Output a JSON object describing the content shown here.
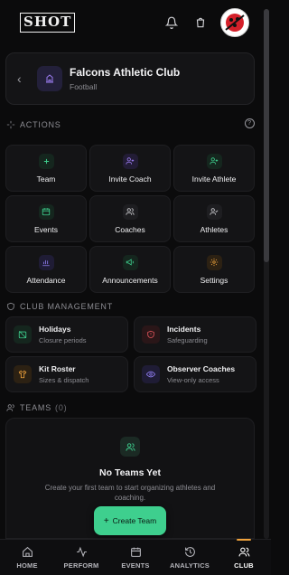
{
  "brand": {
    "logo_text": "SHOT"
  },
  "club": {
    "name": "Falcons Athletic Club",
    "sport": "Football"
  },
  "sections": {
    "actions": "ACTIONS",
    "club_management": "CLUB MANAGEMENT",
    "teams": "TEAMS",
    "teams_count": "(0)"
  },
  "actions": [
    {
      "label": "Team",
      "icon": "plus-icon",
      "color": "#3ecf8e",
      "bg": "#15261e"
    },
    {
      "label": "Invite Coach",
      "icon": "user-plus-icon",
      "color": "#9b7cf0",
      "bg": "#221c35"
    },
    {
      "label": "Invite Athlete",
      "icon": "user-plus-icon",
      "color": "#3ecf8e",
      "bg": "#15261e"
    },
    {
      "label": "Events",
      "icon": "calendar-icon",
      "color": "#3ecf8e",
      "bg": "#15261e"
    },
    {
      "label": "Coaches",
      "icon": "users-icon",
      "color": "#d0d0d4",
      "bg": "#1e1e21"
    },
    {
      "label": "Athletes",
      "icon": "user-check-icon",
      "color": "#d0d0d4",
      "bg": "#1e1e21"
    },
    {
      "label": "Attendance",
      "icon": "bar-chart-icon",
      "color": "#8f7cf0",
      "bg": "#1f1c35"
    },
    {
      "label": "Announcements",
      "icon": "megaphone-icon",
      "color": "#3ecf8e",
      "bg": "#15261e"
    },
    {
      "label": "Settings",
      "icon": "gear-icon",
      "color": "#f0a23c",
      "bg": "#2c2113"
    }
  ],
  "management": [
    {
      "title": "Holidays",
      "sub": "Closure periods",
      "icon": "calendar-off-icon",
      "color": "#3ecf8e",
      "bg": "#15261e"
    },
    {
      "title": "Incidents",
      "sub": "Safeguarding",
      "icon": "shield-alert-icon",
      "color": "#e0545a",
      "bg": "#2a1618"
    },
    {
      "title": "Kit Roster",
      "sub": "Sizes & dispatch",
      "icon": "shirt-icon",
      "color": "#f0a23c",
      "bg": "#2c2113"
    },
    {
      "title": "Observer Coaches",
      "sub": "View-only access",
      "icon": "eye-icon",
      "color": "#8f7cf0",
      "bg": "#1f1c35"
    }
  ],
  "teams_empty": {
    "title": "No Teams Yet",
    "description": "Create your first team to start organizing athletes and coaching.",
    "button": "Create Team"
  },
  "bottom_nav": [
    {
      "label": "HOME",
      "icon": "home-icon",
      "active": false
    },
    {
      "label": "PERFORM",
      "icon": "activity-icon",
      "active": false
    },
    {
      "label": "EVENTS",
      "icon": "calendar-icon",
      "active": false
    },
    {
      "label": "ANALYTICS",
      "icon": "history-icon",
      "active": false
    },
    {
      "label": "CLUB",
      "icon": "users-icon",
      "active": true
    }
  ]
}
